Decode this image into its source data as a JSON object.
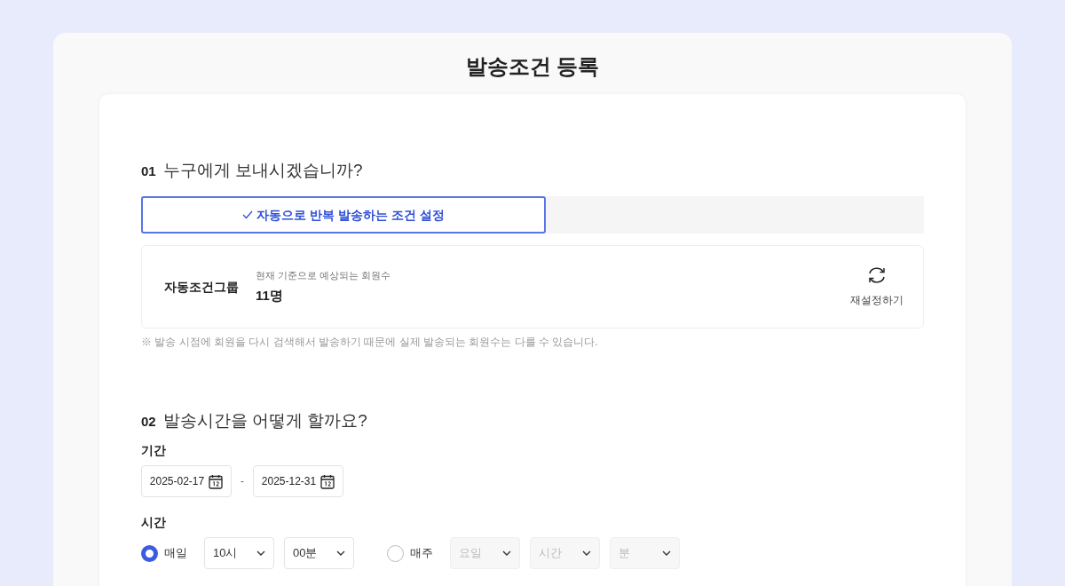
{
  "page_title": "발송조건 등록",
  "section_1": {
    "number": "01",
    "title": "누구에게 보내시겠습니까?",
    "tabs": [
      {
        "label": "자동으로 반복 발송하는 조건 설정",
        "selected": true
      }
    ],
    "group": {
      "label": "자동조건그룹",
      "caption": "현재 기준으로 예상되는 회원수",
      "count": "11명",
      "reset_button": "재설정하기"
    },
    "note": "※ 발송 시점에 회원을 다시 검색해서 발송하기 때문에 실제 발송되는 회원수는 다를 수 있습니다."
  },
  "section_2": {
    "number": "02",
    "title": "발송시간을 어떻게 할까요?",
    "period": {
      "label": "기간",
      "start": "2025-02-17",
      "separator": "-",
      "end": "2025-12-31"
    },
    "time": {
      "label": "시간",
      "options": [
        {
          "label": "매일",
          "selected": true,
          "selects": [
            {
              "value": "10시",
              "disabled": false
            },
            {
              "value": "00분",
              "disabled": false
            }
          ]
        },
        {
          "label": "매주",
          "selected": false,
          "selects": [
            {
              "placeholder": "요일",
              "disabled": true
            },
            {
              "placeholder": "시간",
              "disabled": true
            },
            {
              "placeholder": "분",
              "disabled": true
            }
          ]
        }
      ]
    }
  }
}
